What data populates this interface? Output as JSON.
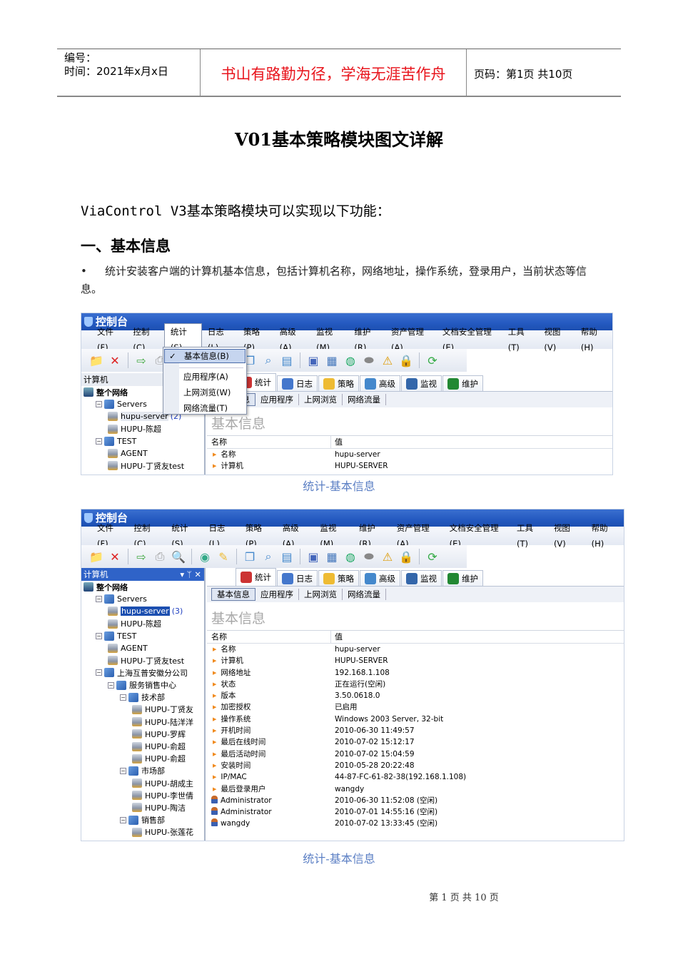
{
  "header": {
    "number_label": "编号：",
    "time_label": "时间：2021年x月x日",
    "motto": "书山有路勤为径，学海无涯苦作舟",
    "page_label": "页码：第1页  共10页"
  },
  "doc": {
    "title": "V01基本策略模块图文详解",
    "intro": "ViaControl V3基本策略模块可以实现以下功能：",
    "section1": "一、基本信息",
    "bullet": "•",
    "para": "统计安装客户端的计算机基本信息，包括计算机名称，网络地址，操作系统，登录用户，当前状态等信息。"
  },
  "app": {
    "title": "控制台",
    "menu": [
      "文件(F)",
      "控制(C)",
      "统计(S)",
      "日志(L)",
      "策略(P)",
      "高级(A)",
      "监视(M)",
      "维护(R)",
      "资产管理(A)",
      "文档安全管理(E)",
      "工具(T)",
      "视图(V)",
      "帮助(H)"
    ],
    "panel_title": "计算机",
    "panel_controls": "▾ ᛘ ✕",
    "tabs": [
      "统计",
      "日志",
      "策略",
      "高级",
      "监视",
      "维护"
    ],
    "subtabs": [
      "基本信息",
      "应用程序",
      "上网浏览",
      "网络流量"
    ],
    "section_heading": "基本信息",
    "col_name": "名称",
    "col_value": "值",
    "dropdown": {
      "checked": "基本信息(B)",
      "items": [
        "应用程序(A)",
        "上网浏览(W)",
        "网络流量(T)"
      ]
    },
    "accent": "#2459c0"
  },
  "shot1": {
    "tree": [
      {
        "label": "整个网络",
        "level": 0,
        "icon": "network-icon",
        "bold": true
      },
      {
        "label": "Servers",
        "level": 1,
        "icon": "group-icon",
        "exp": true
      },
      {
        "label": "hupu-server",
        "level": 2,
        "icon": "computer-icon",
        "count": "(2)",
        "hl": true
      },
      {
        "label": "HUPU-陈超",
        "level": 2,
        "icon": "computer-icon"
      },
      {
        "label": "TEST",
        "level": 1,
        "icon": "group-icon",
        "exp": true
      },
      {
        "label": "AGENT",
        "level": 2,
        "icon": "computer-icon"
      },
      {
        "label": "HUPU-丁贤友test",
        "level": 2,
        "icon": "computer-icon"
      }
    ],
    "rows": [
      {
        "name": "名称",
        "value": "hupu-server"
      },
      {
        "name": "计算机",
        "value": "HUPU-SERVER"
      }
    ],
    "caption": "统计-基本信息"
  },
  "shot2": {
    "tree": [
      {
        "label": "整个网络",
        "level": 0,
        "icon": "network-icon",
        "bold": true
      },
      {
        "label": "Servers",
        "level": 1,
        "icon": "group-icon",
        "exp": true
      },
      {
        "label": "hupu-server",
        "level": 2,
        "icon": "computer-icon",
        "count": "(3)",
        "sel": true
      },
      {
        "label": "HUPU-陈超",
        "level": 2,
        "icon": "computer-icon"
      },
      {
        "label": "TEST",
        "level": 1,
        "icon": "group-icon",
        "exp": true
      },
      {
        "label": "AGENT",
        "level": 2,
        "icon": "computer-icon"
      },
      {
        "label": "HUPU-丁贤友test",
        "level": 2,
        "icon": "computer-icon"
      },
      {
        "label": "上海互普安徽分公司",
        "level": 1,
        "icon": "group-icon",
        "exp": true
      },
      {
        "label": "服务销售中心",
        "level": 2,
        "icon": "group-icon",
        "exp": true
      },
      {
        "label": "技术部",
        "level": 3,
        "icon": "group-icon",
        "exp": true
      },
      {
        "label": "HUPU-丁贤友",
        "level": 4,
        "icon": "computer-icon"
      },
      {
        "label": "HUPU-陆洋洋",
        "level": 4,
        "icon": "computer-icon"
      },
      {
        "label": "HUPU-罗辉",
        "level": 4,
        "icon": "computer-icon"
      },
      {
        "label": "HUPU-俞超",
        "level": 4,
        "icon": "computer-icon"
      },
      {
        "label": "HUPU-俞超",
        "level": 4,
        "icon": "computer-icon"
      },
      {
        "label": "市场部",
        "level": 3,
        "icon": "group-icon",
        "exp": true
      },
      {
        "label": "HUPU-胡成主",
        "level": 4,
        "icon": "computer-icon"
      },
      {
        "label": "HUPU-李世倩",
        "level": 4,
        "icon": "computer-icon"
      },
      {
        "label": "HUPU-陶洁",
        "level": 4,
        "icon": "computer-icon"
      },
      {
        "label": "销售部",
        "level": 3,
        "icon": "group-icon",
        "exp": true
      },
      {
        "label": "HUPU-张莲花",
        "level": 4,
        "icon": "computer-icon"
      }
    ],
    "rows": [
      {
        "name": "名称",
        "value": "hupu-server"
      },
      {
        "name": "计算机",
        "value": "HUPU-SERVER"
      },
      {
        "name": "网络地址",
        "value": "192.168.1.108"
      },
      {
        "name": "状态",
        "value": "正在运行(空闲)"
      },
      {
        "name": "版本",
        "value": "3.50.0618.0"
      },
      {
        "name": "加密授权",
        "value": "已启用"
      },
      {
        "name": "操作系统",
        "value": "Windows 2003 Server, 32-bit"
      },
      {
        "name": "开机时间",
        "value": "2010-06-30 11:49:57"
      },
      {
        "name": "最后在线时间",
        "value": "2010-07-02 15:12:17"
      },
      {
        "name": "最后活动时间",
        "value": "2010-07-02 15:04:59"
      },
      {
        "name": "安装时间",
        "value": "2010-05-28 20:22:48"
      },
      {
        "name": "IP/MAC",
        "value": "44-87-FC-61-82-38(192.168.1.108)"
      },
      {
        "name": "最后登录用户",
        "value": "wangdy"
      },
      {
        "name": "Administrator",
        "value": "2010-06-30 11:52:08 (空闲)",
        "user": true
      },
      {
        "name": "Administrator",
        "value": "2010-07-01 14:55:16 (空闲)",
        "user": true
      },
      {
        "name": "wangdy",
        "value": "2010-07-02 13:33:45 (空闲)",
        "user": true
      }
    ],
    "caption": "统计-基本信息"
  },
  "footer": "第 1 页 共 10 页"
}
